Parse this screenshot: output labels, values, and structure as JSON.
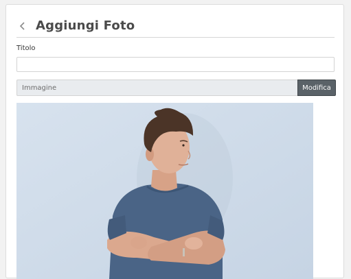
{
  "header": {
    "back_icon": "chevron-left-icon",
    "title": "Aggiungi Foto"
  },
  "form": {
    "title_label": "Titolo",
    "title_value": "",
    "image_placeholder": "Immagine",
    "modify_button": "Modifica"
  },
  "colors": {
    "button_bg": "#5a6268",
    "photo_bg": "#cfdceb",
    "shirt": "#4a6486"
  }
}
